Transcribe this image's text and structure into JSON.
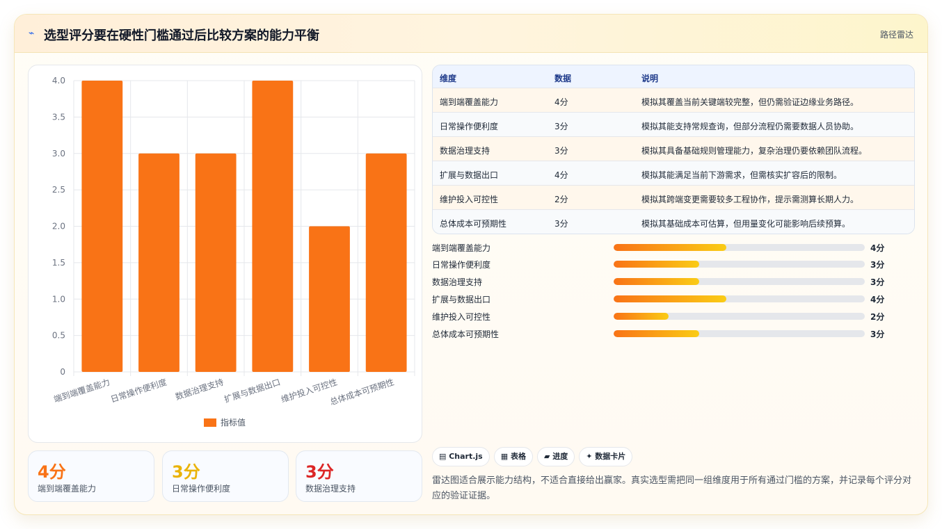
{
  "header": {
    "icon": "⌁",
    "title": "选型评分要在硬性门槛通过后比较方案的能力平衡",
    "tag": "路径雷达"
  },
  "chart_data": {
    "type": "bar",
    "categories": [
      "端到端覆盖能力",
      "日常操作便利度",
      "数据治理支持",
      "扩展与数据出口",
      "维护投入可控性",
      "总体成本可预期性"
    ],
    "series": [
      {
        "name": "指标值",
        "values": [
          4,
          3,
          3,
          4,
          2,
          3
        ],
        "color": "#f97316"
      }
    ],
    "ylim": [
      0,
      4
    ],
    "yticks": [
      "0",
      "0.5",
      "1.0",
      "1.5",
      "2.0",
      "2.5",
      "3.0",
      "3.5",
      "4.0"
    ],
    "legend": "bottom",
    "grid": true
  },
  "stats": [
    {
      "value": "4分",
      "label": "端到端覆盖能力",
      "color": "#f97316"
    },
    {
      "value": "3分",
      "label": "日常操作便利度",
      "color": "#eab308"
    },
    {
      "value": "3分",
      "label": "数据治理支持",
      "color": "#dc2626"
    }
  ],
  "table": {
    "headers": [
      "维度",
      "数据",
      "说明"
    ],
    "rows": [
      [
        "端到端覆盖能力",
        "4分",
        "模拟其覆盖当前关键端较完整，但仍需验证边缘业务路径。"
      ],
      [
        "日常操作便利度",
        "3分",
        "模拟其能支持常规查询，但部分流程仍需要数据人员协助。"
      ],
      [
        "数据治理支持",
        "3分",
        "模拟其具备基础规则管理能力，复杂治理仍要依赖团队流程。"
      ],
      [
        "扩展与数据出口",
        "4分",
        "模拟其能满足当前下游需求，但需核实扩容后的限制。"
      ],
      [
        "维护投入可控性",
        "2分",
        "模拟其跨端变更需要较多工程协作，提示需测算长期人力。"
      ],
      [
        "总体成本可预期性",
        "3分",
        "模拟其基础成本可估算，但用量变化可能影响后续预算。"
      ]
    ]
  },
  "progress": [
    {
      "label": "端到端覆盖能力",
      "value": "4分",
      "fraction": 0.45
    },
    {
      "label": "日常操作便利度",
      "value": "3分",
      "fraction": 0.34
    },
    {
      "label": "数据治理支持",
      "value": "3分",
      "fraction": 0.34
    },
    {
      "label": "扩展与数据出口",
      "value": "4分",
      "fraction": 0.45
    },
    {
      "label": "维护投入可控性",
      "value": "2分",
      "fraction": 0.22
    },
    {
      "label": "总体成本可预期性",
      "value": "3分",
      "fraction": 0.34
    }
  ],
  "chips": [
    "▤ Chart.js",
    "▦ 表格",
    "▰ 进度",
    "✦ 数据卡片"
  ],
  "note": "雷达图适合展示能力结构，不适合直接给出赢家。真实选型需把同一组维度用于所有通过门槛的方案，并记录每个评分对应的验证证据。"
}
